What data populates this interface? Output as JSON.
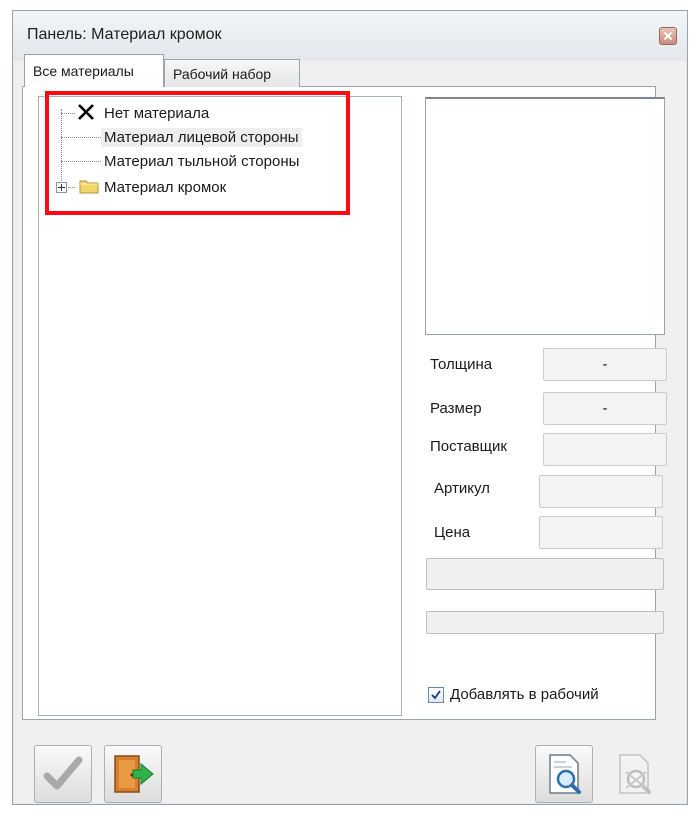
{
  "window": {
    "title": "Панель: Материал кромок"
  },
  "tabs": [
    {
      "label": "Все материалы",
      "active": true
    },
    {
      "label": "Рабочий набор",
      "active": false
    }
  ],
  "tree": {
    "items": [
      {
        "label": "Нет материала",
        "icon": "no-material-x-icon"
      },
      {
        "label": "Материал лицевой стороны",
        "icon": "none"
      },
      {
        "label": "Материал тыльной стороны",
        "icon": "none"
      },
      {
        "label": "Материал кромок",
        "icon": "folder-icon",
        "expandable": true
      }
    ]
  },
  "properties": {
    "thickness_label": "Толщина",
    "thickness_value": "-",
    "size_label": "Размер",
    "size_value": "-",
    "supplier_label": "Поставщик",
    "supplier_value": "",
    "article_label": "Артикул",
    "article_value": "",
    "price_label": "Цена",
    "price_value": ""
  },
  "add_to_workset": {
    "label": "Добавлять в рабочий",
    "checked": true
  },
  "colors": {
    "highlight": "#ff0a12",
    "window_bg": "#f0f0f0"
  }
}
